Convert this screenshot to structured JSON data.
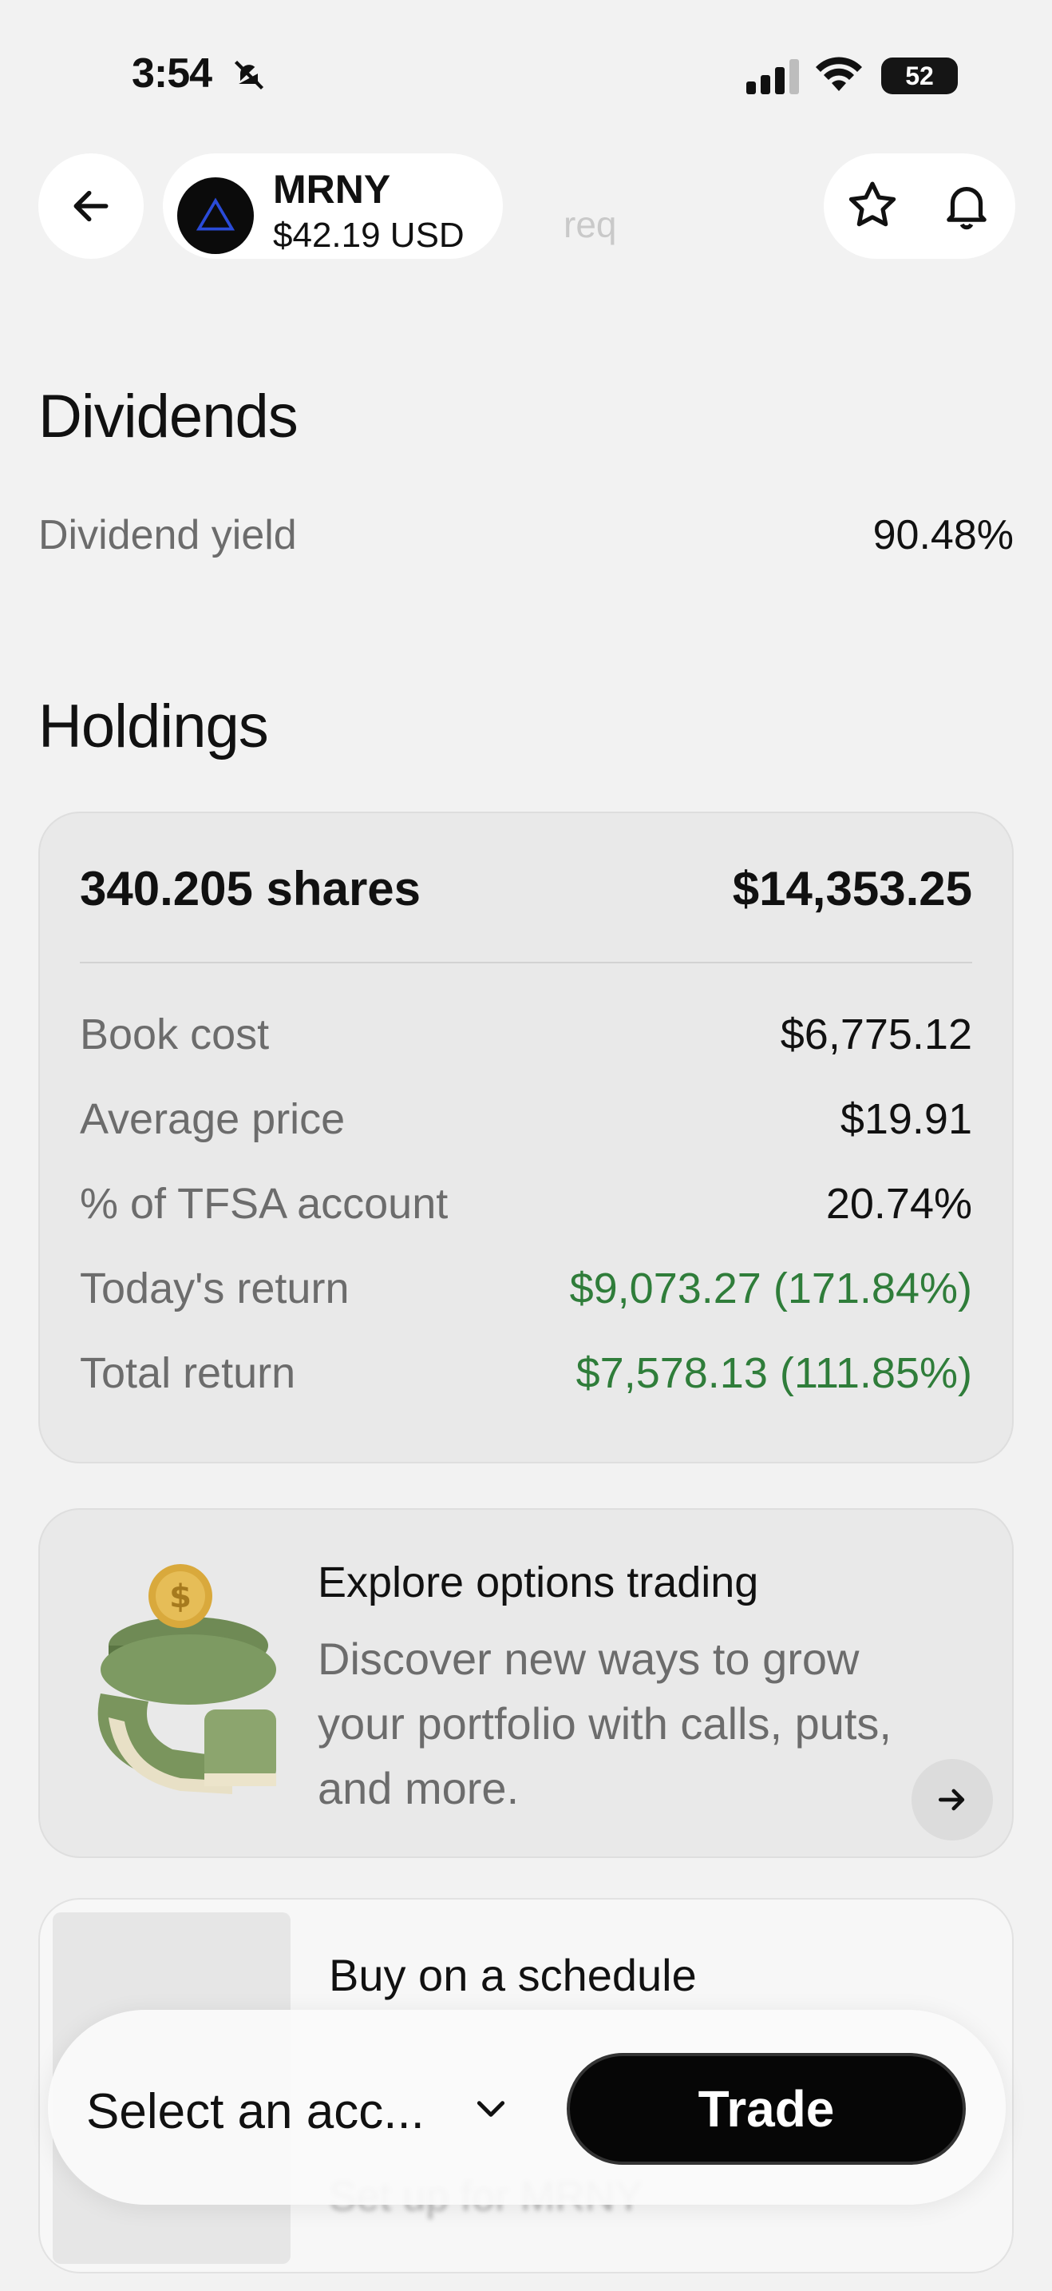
{
  "status_bar": {
    "time": "3:54",
    "battery": "52"
  },
  "header": {
    "symbol": "MRNY",
    "price": "$42.19 USD",
    "ghost_text": "req",
    "icons": [
      "back-arrow-icon",
      "triangle-logo-icon",
      "star-icon",
      "bell-icon"
    ]
  },
  "dividends": {
    "title": "Dividends",
    "yield_label": "Dividend yield",
    "yield_value": "90.48%"
  },
  "holdings": {
    "title": "Holdings",
    "shares": "340.205 shares",
    "market_value": "$14,353.25",
    "rows": [
      {
        "label": "Book cost",
        "value": "$6,775.12",
        "positive": false
      },
      {
        "label": "Average price",
        "value": "$19.91",
        "positive": false
      },
      {
        "label": "% of TFSA account",
        "value": "20.74%",
        "positive": false
      },
      {
        "label": "Today's return",
        "value": "$9,073.27 (171.84%)",
        "positive": true
      },
      {
        "label": "Total return",
        "value": "$7,578.13 (111.85%)",
        "positive": true
      }
    ]
  },
  "options_promo": {
    "title": "Explore options trading",
    "description": "Discover new ways to grow your portfolio with calls, puts, and more."
  },
  "schedule_promo": {
    "title": "Buy on a schedule",
    "subtitle": "Set up for MRNY"
  },
  "bottom_bar": {
    "account_select": "Select an acc...",
    "trade_label": "Trade"
  },
  "colors": {
    "positive": "#2f7d3a",
    "accent": "#2a4bd8",
    "trade_bg": "#060606"
  }
}
